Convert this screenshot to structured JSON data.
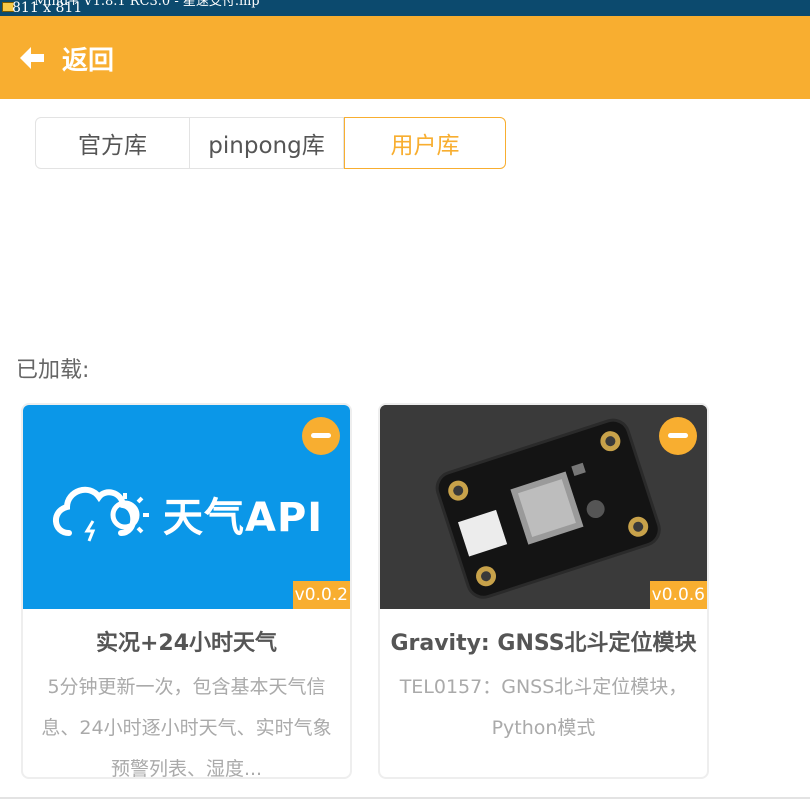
{
  "window": {
    "title": "Mind+ V1.8.1 RC3.0 - 星速支付.mp",
    "size_readout": "811 x 811"
  },
  "header": {
    "back_label": "返回"
  },
  "tabs": [
    {
      "label": "官方库"
    },
    {
      "label": "pinpong库"
    },
    {
      "label": "用户库"
    }
  ],
  "loaded": {
    "label": "已加载:"
  },
  "cards": [
    {
      "logo_text": "天气API",
      "version": "v0.0.2",
      "title": "实况+24小时天气",
      "description": "5分钟更新一次，包含基本天气信息、24小时逐小时天气、实时气象预警列表、湿度..."
    },
    {
      "version": "v0.0.6",
      "title": "Gravity: GNSS北斗定位模块",
      "description": "TEL0157：GNSS北斗定位模块，Python模式"
    }
  ],
  "colors": {
    "accent": "#f8ae30",
    "weather_bg": "#0b97e8"
  }
}
